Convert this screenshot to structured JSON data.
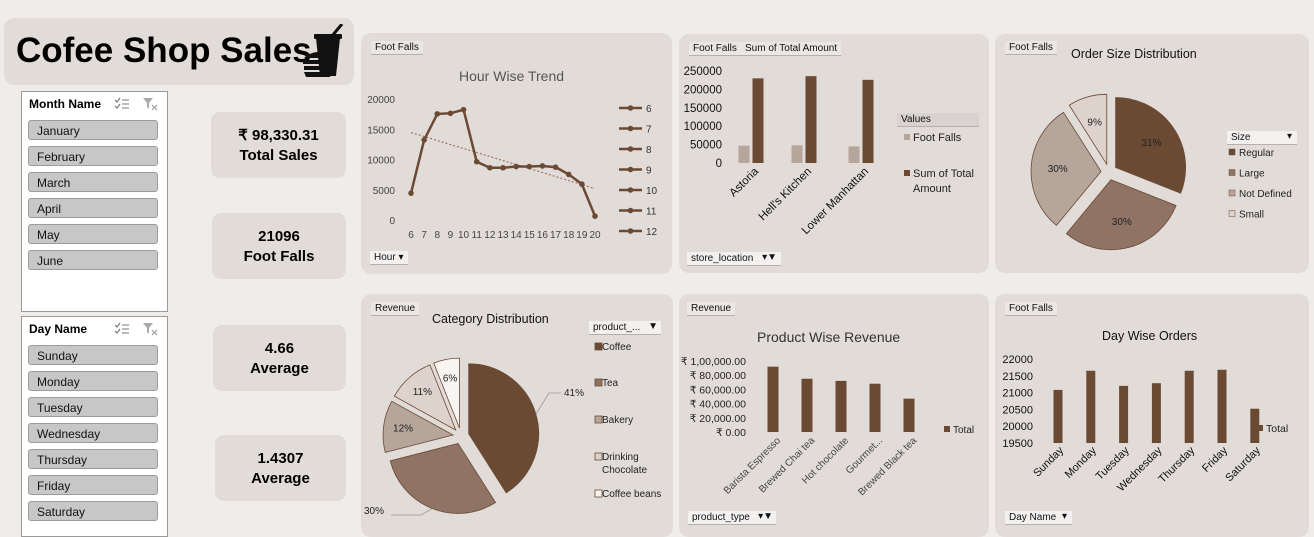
{
  "app": {
    "title": "Cofee Shop Sales",
    "icon": "coffee-burger-icon"
  },
  "month_slicer": {
    "title": "Month Name",
    "items": [
      "January",
      "February",
      "March",
      "April",
      "May",
      "June"
    ]
  },
  "day_slicer": {
    "title": "Day Name",
    "items": [
      "Sunday",
      "Monday",
      "Tuesday",
      "Wednesday",
      "Thursday",
      "Friday",
      "Saturday"
    ]
  },
  "kpis": [
    {
      "value": "₹ 98,330.31",
      "label": "Total Sales"
    },
    {
      "value": "21096",
      "label": "Foot Falls"
    },
    {
      "value": "4.66",
      "label": "Average"
    },
    {
      "value": "1.4307",
      "label": "Average"
    }
  ],
  "colors": {
    "dark": "#6b4a34",
    "medium": "#8f7364",
    "light": "#b5a59b",
    "pale": "#ddd3cc",
    "panel": "#e2dcd9",
    "background": "#efecea"
  },
  "chart_data": [
    {
      "id": "hour_trend",
      "type": "line",
      "title": "Hour Wise Trend",
      "field_button": "Foot Falls",
      "axis_button": "Hour",
      "x": [
        6,
        7,
        8,
        9,
        10,
        11,
        12,
        13,
        14,
        15,
        16,
        17,
        18,
        19,
        20
      ],
      "y": [
        4600,
        13400,
        17700,
        17800,
        18400,
        9800,
        8800,
        8800,
        9000,
        9000,
        9100,
        8900,
        7700,
        6100,
        800
      ],
      "ylim": [
        0,
        20000
      ],
      "yticks": [
        0,
        5000,
        10000,
        15000,
        20000
      ],
      "trendline": "linear",
      "legend": [
        "6",
        "7",
        "8",
        "9",
        "10",
        "11",
        "12"
      ],
      "legend_position": "right"
    },
    {
      "id": "store_bars",
      "type": "bar",
      "field_buttons": [
        "Foot Falls",
        "Sum of Total Amount"
      ],
      "axis_button": "store_location",
      "categories": [
        "Astoria",
        "Hell's Kitchen",
        "Lower Manhattan"
      ],
      "series": [
        {
          "name": "Foot Falls",
          "values": [
            47000,
            48000,
            45000
          ]
        },
        {
          "name": "Sum of Total Amount",
          "values": [
            230000,
            236000,
            226000
          ]
        }
      ],
      "ylim": [
        0,
        250000
      ],
      "yticks": [
        0,
        50000,
        100000,
        150000,
        200000,
        250000
      ],
      "legend_title": "Values",
      "legend_position": "right"
    },
    {
      "id": "order_size",
      "type": "pie",
      "title": "Order Size Distribution",
      "field_button": "Foot Falls",
      "legend_title": "Size",
      "categories": [
        "Regular",
        "Large",
        "Not Defined",
        "Small"
      ],
      "values": [
        31,
        30,
        30,
        9
      ],
      "labels": [
        "31%",
        "30%",
        "30%",
        "9%"
      ],
      "legend_position": "right"
    },
    {
      "id": "category_dist",
      "type": "pie",
      "title": "Category Distribution",
      "field_button": "Revenue",
      "legend_title": "product_...",
      "categories": [
        "Coffee",
        "Tea",
        "Bakery",
        "Drinking Chocolate",
        "Coffee beans"
      ],
      "values": [
        41,
        30,
        12,
        11,
        6
      ],
      "labels": [
        "41%",
        "30%",
        "12%",
        "11%",
        "6%"
      ],
      "legend_position": "right"
    },
    {
      "id": "product_revenue",
      "type": "bar",
      "title": "Product Wise Revenue",
      "field_button": "Revenue",
      "axis_button": "product_type",
      "categories": [
        "Barista Espresso",
        "Brewed Chai tea",
        "Hot chocolate",
        "Gourmet...",
        "Brewed Black tea"
      ],
      "values": [
        92000,
        75000,
        72000,
        68000,
        47000
      ],
      "ylim": [
        0,
        100000
      ],
      "ytick_labels": [
        "₹ 0.00",
        "₹ 20,000.00",
        "₹ 40,000.00",
        "₹ 60,000.00",
        "₹ 80,000.00",
        "₹ 1,00,000.00"
      ],
      "legend": [
        "Total"
      ],
      "legend_position": "right"
    },
    {
      "id": "day_orders",
      "type": "bar",
      "title": "Day Wise Orders",
      "field_button": "Foot Falls",
      "axis_button": "Day Name",
      "categories": [
        "Sunday",
        "Monday",
        "Tuesday",
        "Wednesday",
        "Thursday",
        "Friday",
        "Saturday"
      ],
      "values": [
        21080,
        21650,
        21200,
        21280,
        21650,
        21680,
        20520
      ],
      "ylim": [
        19500,
        22000
      ],
      "yticks": [
        19500,
        20000,
        20500,
        21000,
        21500,
        22000
      ],
      "legend": [
        "Total"
      ],
      "legend_position": "right"
    }
  ]
}
